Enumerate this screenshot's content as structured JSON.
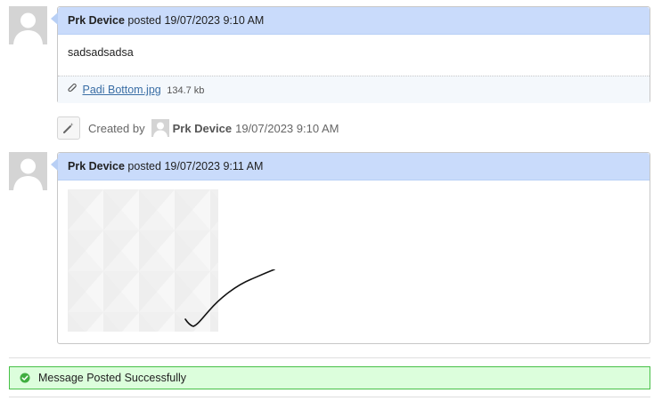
{
  "posts": [
    {
      "author": "Prk Device",
      "posted_word": "posted",
      "datetime": "19/07/2023 9:10 AM",
      "body": "sadsadsadsa",
      "attachment": {
        "filename": "Padi Bottom.jpg",
        "size": "134.7 kb"
      }
    },
    {
      "author": "Prk Device",
      "posted_word": "posted",
      "datetime": "19/07/2023 9:11 AM"
    }
  ],
  "activity": {
    "created_by_label": "Created by",
    "author": "Prk Device",
    "datetime": "19/07/2023 9:10 AM"
  },
  "status_message": "Message Posted Successfully",
  "colors": {
    "header_bg": "#c9dbfb",
    "success_bg": "#dcfedc",
    "success_border": "#47c147",
    "link": "#3a6ea5"
  }
}
